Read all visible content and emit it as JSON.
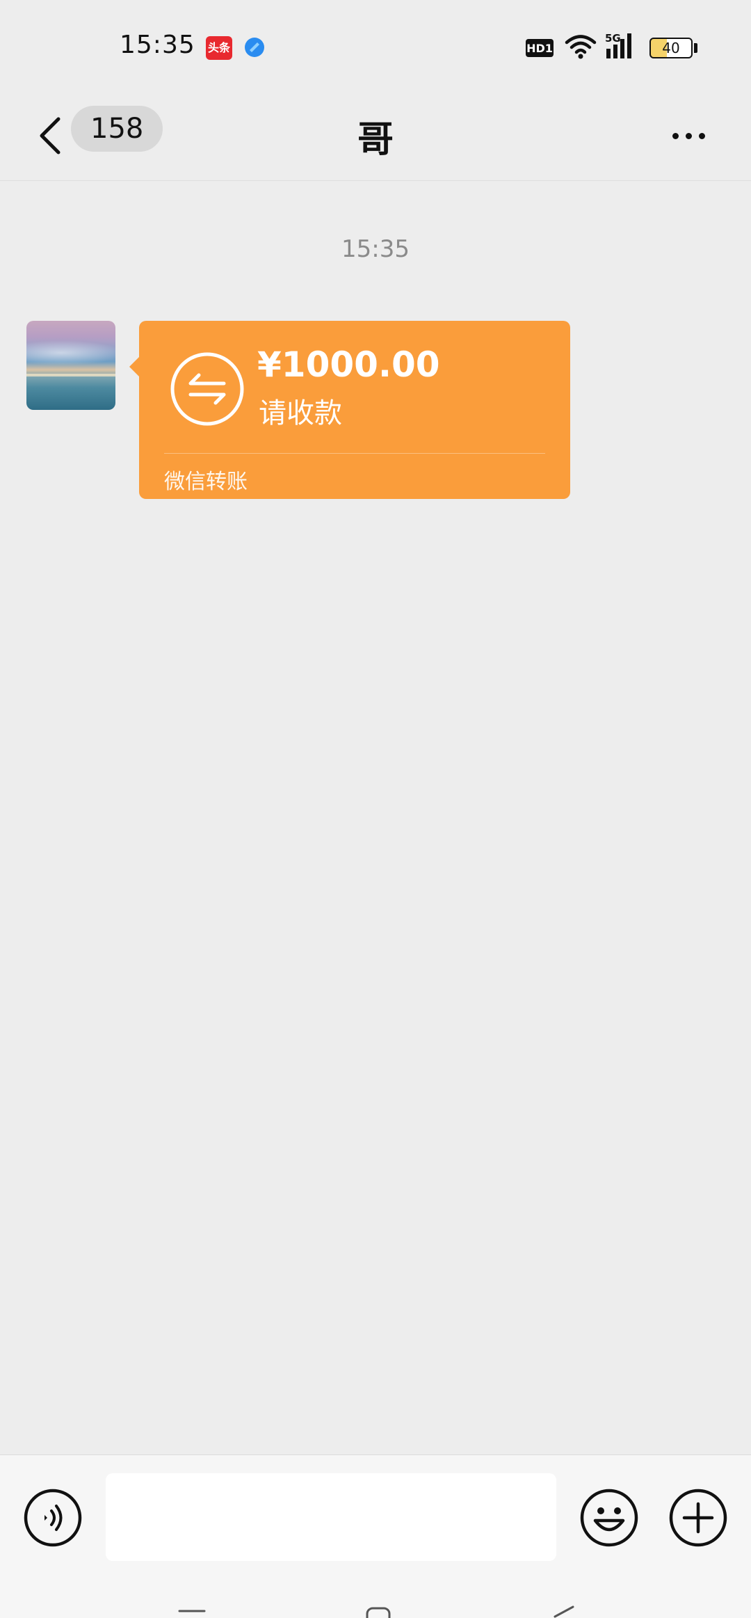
{
  "status_bar": {
    "time": "15:35",
    "toutiao_icon_text": "头条",
    "hd_badge": "HD1",
    "network": "5G",
    "battery_level": "40"
  },
  "nav": {
    "unread_count": "158",
    "title": "哥"
  },
  "messages": {
    "timestamp": "15:35",
    "transfer": {
      "amount": "¥1000.00",
      "status": "请收款",
      "source": "微信转账",
      "color": "#fa9d3b"
    }
  },
  "input_bar": {
    "text_value": "",
    "placeholder": ""
  },
  "icons": {
    "back": "chevron-left-icon",
    "more": "ellipsis-icon",
    "transfer": "transfer-arrows-icon",
    "voice": "voice-icon",
    "emoji": "emoji-icon",
    "plus": "plus-icon"
  }
}
